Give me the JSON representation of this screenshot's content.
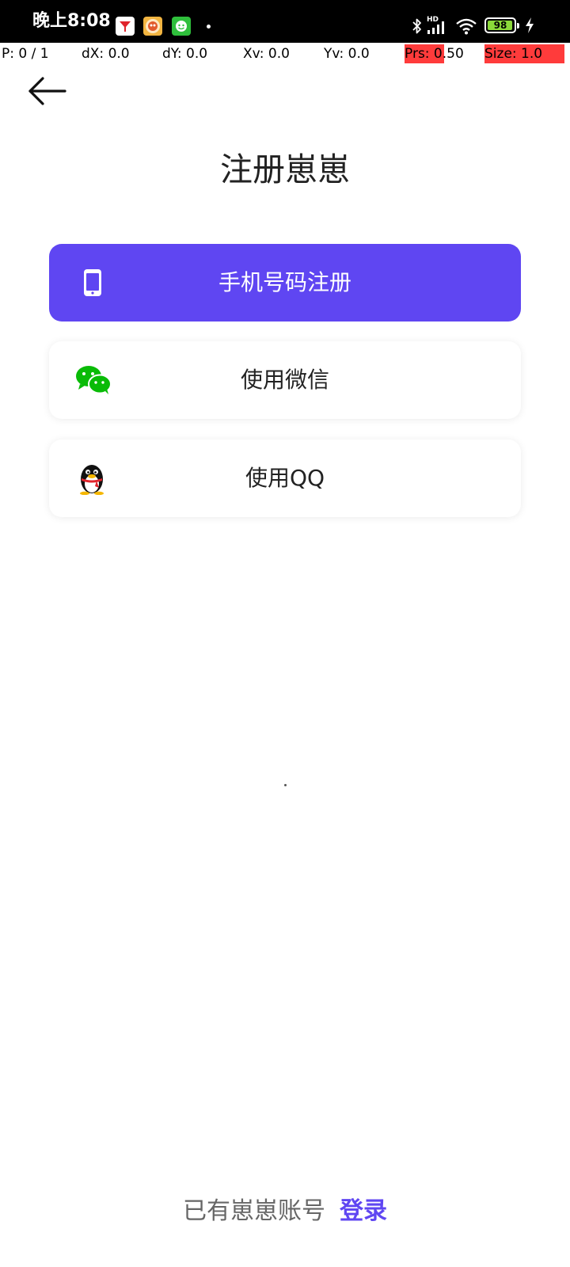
{
  "status_bar": {
    "time": "晚上8:08",
    "battery": "98",
    "network_badge": "HD",
    "icons": [
      "toutiao-icon",
      "game-app-icon",
      "wechat-notify-icon",
      "bluetooth-icon",
      "signal-icon",
      "wifi-icon",
      "battery-icon",
      "charging-icon"
    ]
  },
  "debug": {
    "pointer": "P: 0 / 1",
    "dx": "dX: 0.0",
    "dy": "dY: 0.0",
    "xv": "Xv: 0.0",
    "yv": "Yv: 0.0",
    "prs": "Prs: 0.50",
    "size": "Size: 1.0",
    "highlight_color": "#ff3b3b"
  },
  "header": {
    "back_icon": "arrow-left-icon",
    "title": "注册崽崽"
  },
  "options": {
    "phone": {
      "label": "手机号码注册",
      "icon": "phone-icon",
      "bg_color": "#5f46f2"
    },
    "wechat": {
      "label": "使用微信",
      "icon": "wechat-icon",
      "icon_color": "#09bb07"
    },
    "qq": {
      "label": "使用QQ",
      "icon": "qq-penguin-icon"
    }
  },
  "footer": {
    "prompt": "已有崽崽账号",
    "login_link": "登录",
    "accent_color": "#5f46f2"
  }
}
